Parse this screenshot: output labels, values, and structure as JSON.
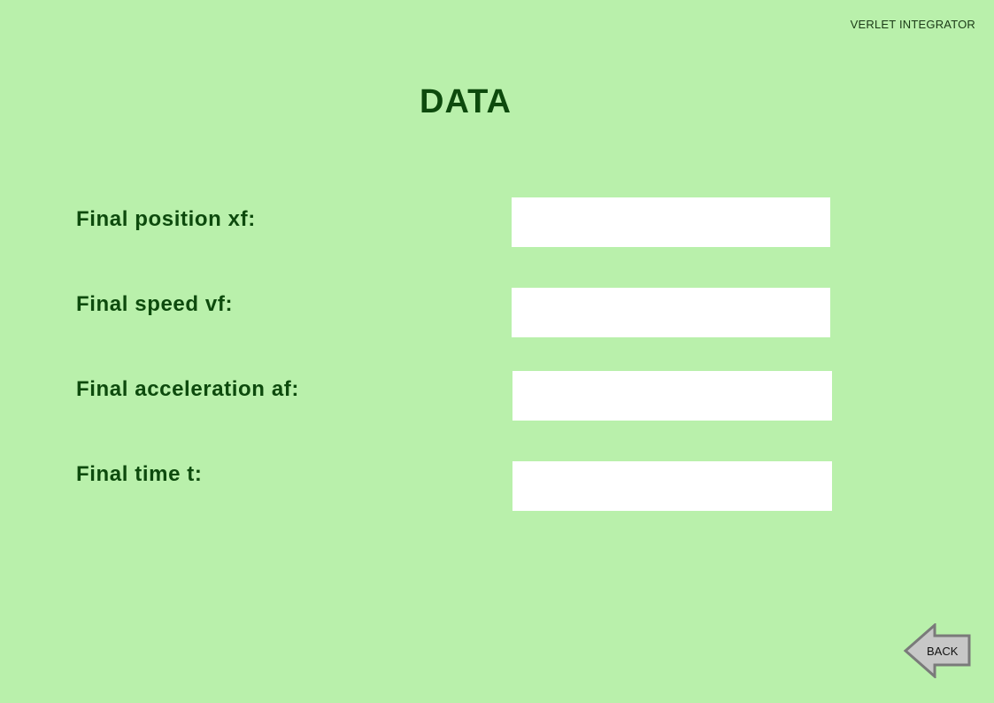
{
  "header": {
    "app_title": "VERLET INTEGRATOR",
    "page_title": "DATA"
  },
  "fields": [
    {
      "label": "Final position xf:",
      "value": ""
    },
    {
      "label": "Final speed vf:",
      "value": ""
    },
    {
      "label": "Final acceleration af:",
      "value": ""
    },
    {
      "label": "Final time t:",
      "value": ""
    }
  ],
  "footer": {
    "back_label": "BACK",
    "back_icon": "left-arrow-icon"
  },
  "colors": {
    "background": "#b9f0ab",
    "text": "#0d4a0d",
    "input_background": "#ffffff",
    "button_fill": "#c7c7c7",
    "button_stroke": "#7a7a7a"
  }
}
